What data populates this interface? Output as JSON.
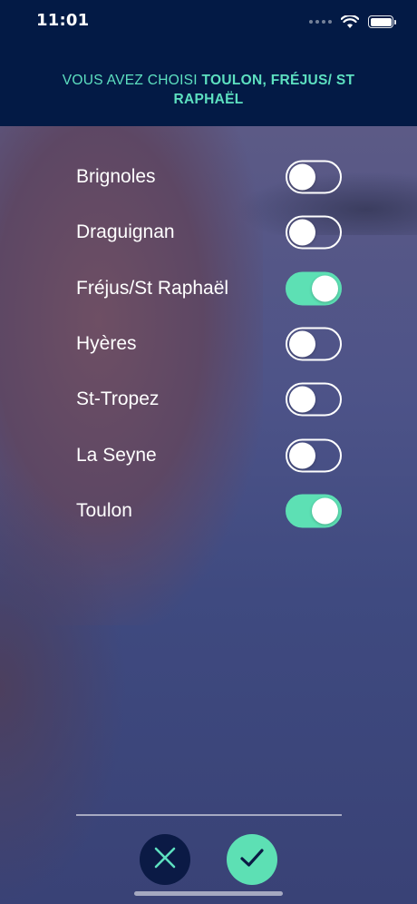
{
  "status_bar": {
    "time": "11:01",
    "icons": [
      "signal-dots-icon",
      "wifi-icon",
      "battery-icon"
    ]
  },
  "header": {
    "prefix": "VOUS AVEZ CHOISI ",
    "selected_text": "TOULON, FRÉJUS/ ST RAPHAËL",
    "accent_color": "#5de0c0",
    "background_color": "#031a45"
  },
  "cities": [
    {
      "label": "Brignoles",
      "enabled": false
    },
    {
      "label": "Draguignan",
      "enabled": false
    },
    {
      "label": "Fréjus/St Raphaël",
      "enabled": true
    },
    {
      "label": "Hyères",
      "enabled": false
    },
    {
      "label": "St-Tropez",
      "enabled": false
    },
    {
      "label": "La Seyne",
      "enabled": false
    },
    {
      "label": "Toulon",
      "enabled": true
    }
  ],
  "actions": {
    "cancel_icon": "close-icon",
    "confirm_icon": "check-icon",
    "toggle_on_color": "#5de0b4"
  }
}
